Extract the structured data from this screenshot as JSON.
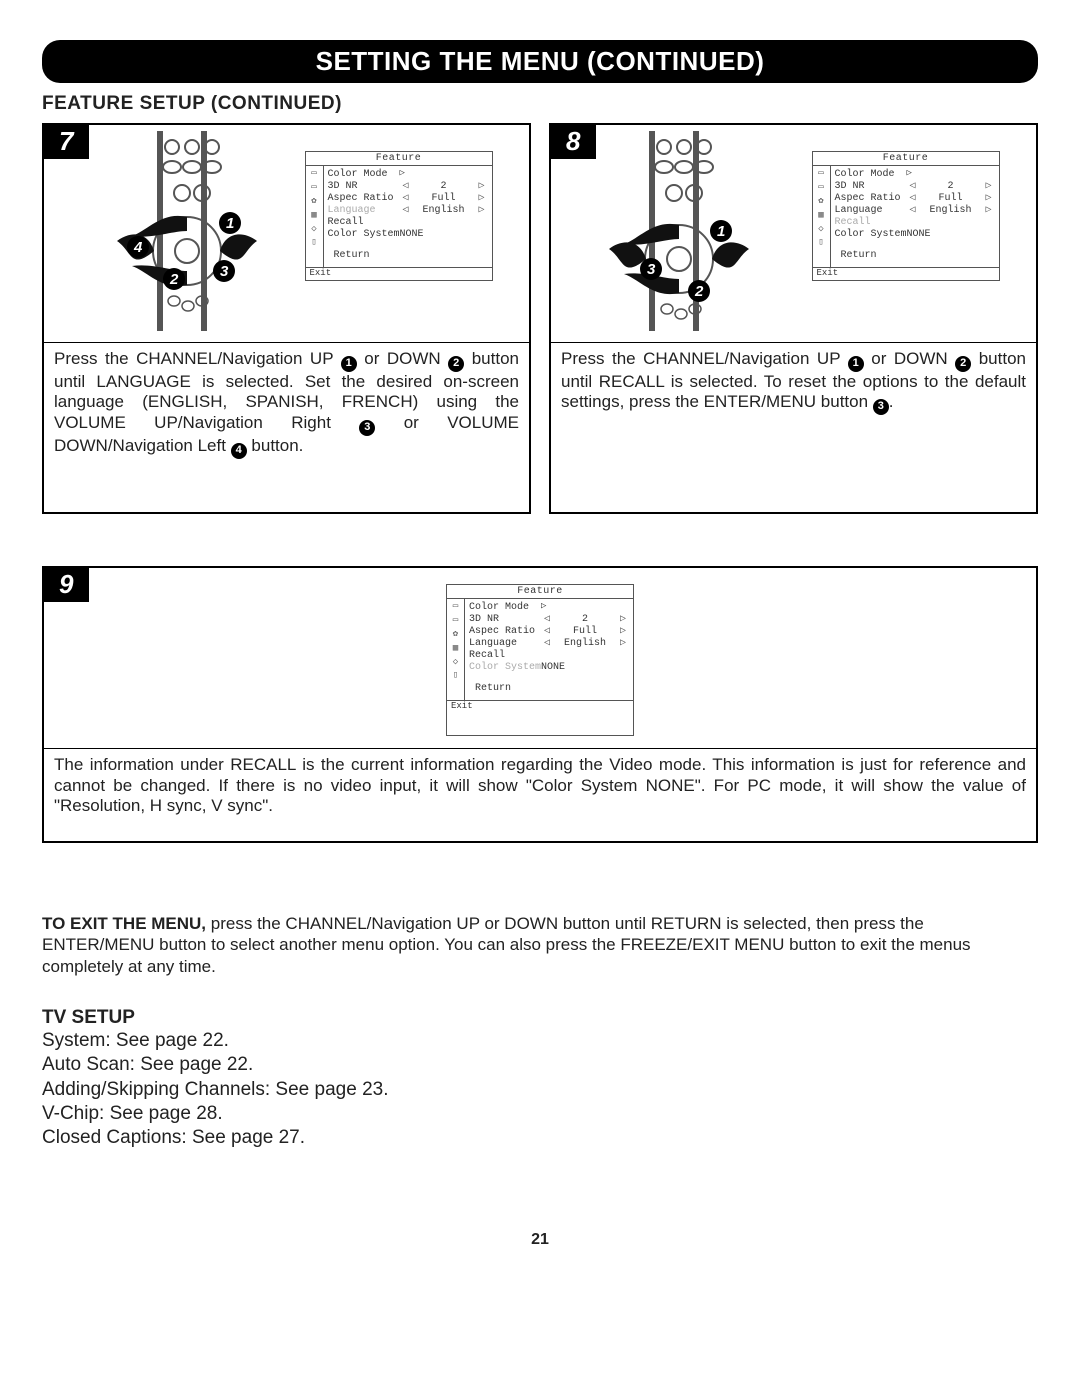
{
  "banner_title": "SETTING THE MENU (CONTINUED)",
  "subhead": "FEATURE SETUP (CONTINUED)",
  "osd": {
    "title": "Feature",
    "items": [
      {
        "label": "Color Mode",
        "value": ""
      },
      {
        "label": "3D NR",
        "value": "2"
      },
      {
        "label": "Aspec Ratio",
        "value": "Full"
      },
      {
        "label": "Language",
        "value": "English"
      },
      {
        "label": "Recall",
        "value": ""
      },
      {
        "label": "Color System",
        "value": "NONE"
      }
    ],
    "return": "Return",
    "exit": "Exit"
  },
  "steps": {
    "s7": {
      "num": "7",
      "highlighted_row": "Language",
      "caption_parts": [
        "Press the CHANNEL/Navigation UP ",
        " or DOWN ",
        " button until LANGUAGE is selected. Set the desired on-screen language (ENGLISH, SPANISH, FRENCH) using the VOLUME UP/Navigation Right ",
        " or VOLUME DOWN/Navigation Left ",
        " button."
      ]
    },
    "s8": {
      "num": "8",
      "highlighted_row": "Recall",
      "caption_parts": [
        "Press the CHANNEL/Navigation UP ",
        " or DOWN ",
        " button until RECALL is selected. To reset the options to the default settings, press the ENTER/MENU button ",
        "."
      ]
    },
    "s9": {
      "num": "9",
      "highlighted_row": "Color System",
      "caption": "The information under RECALL is the current information regarding the Video mode. This information is just for reference and cannot be changed. If there is no video input, it will show \"Color System NONE\". For PC mode, it will show the value of \"Resolution, H sync, V sync\"."
    }
  },
  "exit_note_bold": "TO EXIT THE MENU,",
  "exit_note_rest": " press the CHANNEL/Navigation UP or DOWN button until RETURN is selected, then press the ENTER/MENU button to select another menu option. You can also press the FREEZE/EXIT MENU button to exit the menus completely at any time.",
  "tv_setup": {
    "head": "TV SETUP",
    "lines": [
      "System: See page 22.",
      "Auto Scan: See page 22.",
      "Adding/Skipping Channels: See page 23.",
      "V-Chip: See page 28.",
      "Closed Captions: See page 27."
    ]
  },
  "page_number": "21",
  "circled": {
    "one": "1",
    "two": "2",
    "three": "3",
    "four": "4"
  }
}
